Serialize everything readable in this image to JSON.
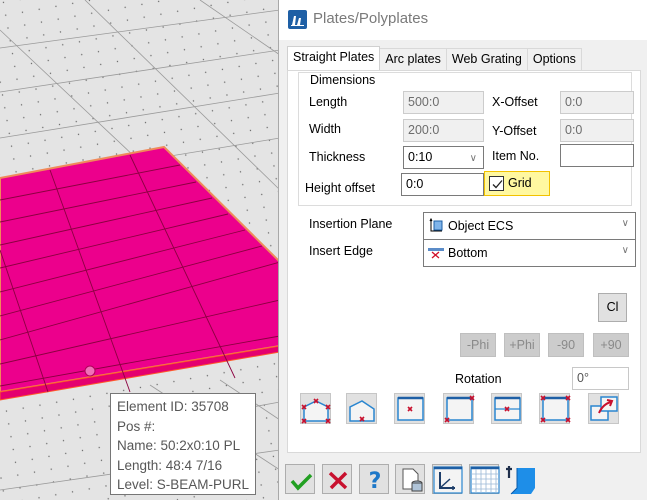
{
  "viewport": {
    "background_color": "#e4e4e4",
    "plate_color": "#ec008c",
    "tooltip": {
      "lines": [
        "Element ID: 35708",
        "Pos #:",
        "Name: 50:2x0:10 PL",
        "Length: 48:4 7/16",
        "Level: S-BEAM-PURL"
      ]
    }
  },
  "dialog": {
    "title": "Plates/Polyplates",
    "tabs": [
      {
        "label": "Straight Plates",
        "active": true
      },
      {
        "label": "Arc plates",
        "active": false
      },
      {
        "label": "Web Grating",
        "active": false
      },
      {
        "label": "Options",
        "active": false
      }
    ],
    "dimensions": {
      "legend": "Dimensions",
      "length": {
        "label": "Length",
        "value": "500:0"
      },
      "width": {
        "label": "Width",
        "value": "200:0"
      },
      "thickness": {
        "label": "Thickness",
        "value": "0:10"
      },
      "height_offset": {
        "label": "Height offset",
        "value": "0:0"
      },
      "x_offset": {
        "label": "X-Offset",
        "value": "0:0"
      },
      "y_offset": {
        "label": "Y-Offset",
        "value": "0:0"
      },
      "item_no": {
        "label": "Item No.",
        "value": ""
      },
      "grid": {
        "label": "Grid",
        "checked": true
      }
    },
    "insertion_plane": {
      "label": "Insertion Plane",
      "value": "Object ECS"
    },
    "insert_edge": {
      "label": "Insert Edge",
      "value": "Bottom"
    },
    "cl_button": "Cl",
    "rotation_buttons": [
      "-Phi",
      "+Phi",
      "-90",
      "+90"
    ],
    "rotation": {
      "label": "Rotation",
      "value": "0°"
    },
    "insertion_point_buttons": [
      "polygon-all-points-icon",
      "polygon-bottom-point-icon",
      "center-point-icon",
      "diagonal-corners-icon",
      "center-line-icon",
      "four-corners-icon",
      "move-copy-icon"
    ],
    "footer_buttons": [
      "ok-check-icon",
      "cancel-x-icon",
      "help-icon",
      "database-document-icon",
      "ucs-axis-icon",
      "grid-table-icon",
      "plate-3d-icon"
    ],
    "colors": {
      "accent": "#1e78c8",
      "grid_highlight": "#fff8a0"
    }
  }
}
